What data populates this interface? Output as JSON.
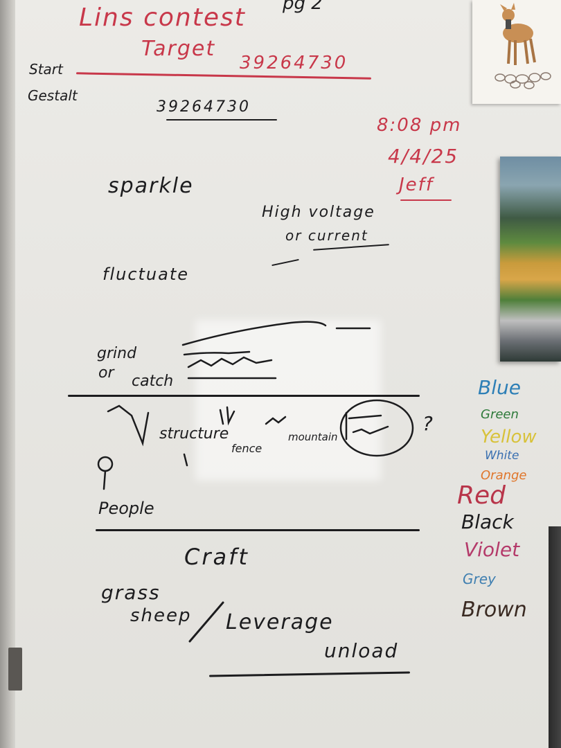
{
  "header": {
    "title": "Lins contest",
    "target_label": "Target",
    "target_number": "39264730",
    "start_label": "Start",
    "gestalt_label": "Gestalt",
    "gestalt_number": "39264730",
    "corner_mark": "pg 2"
  },
  "session": {
    "time": "8:08 pm",
    "date": "4/4/25",
    "name": "Jeff"
  },
  "notes": {
    "sparkle": "sparkle",
    "high_voltage": "High voltage",
    "or_current": "or current",
    "fluctuate": "fluctuate",
    "grind_or": "grind",
    "or": "or",
    "catch": "catch",
    "structure": "structure",
    "fence": "fence",
    "mountain": "mountain",
    "question": "?",
    "people": "People",
    "craft": "Craft",
    "grass": "grass",
    "sheep": "sheep",
    "leverage": "Leverage",
    "unload": "unload"
  },
  "color_list": [
    {
      "label": "Blue",
      "color": "#2d7fb6"
    },
    {
      "label": "Green",
      "color": "#2e7a3a"
    },
    {
      "label": "Yellow",
      "color": "#d8c23a"
    },
    {
      "label": "White",
      "color": "#3a6fb0"
    },
    {
      "label": "Orange",
      "color": "#e0762b"
    },
    {
      "label": "Red",
      "color": "#b8354a"
    },
    {
      "label": "Black",
      "color": "#1c1c1e"
    },
    {
      "label": "Violet",
      "color": "#b43a6a"
    },
    {
      "label": "Grey",
      "color": "#3f7fb0"
    },
    {
      "label": "Brown",
      "color": "#3a2a22"
    }
  ]
}
